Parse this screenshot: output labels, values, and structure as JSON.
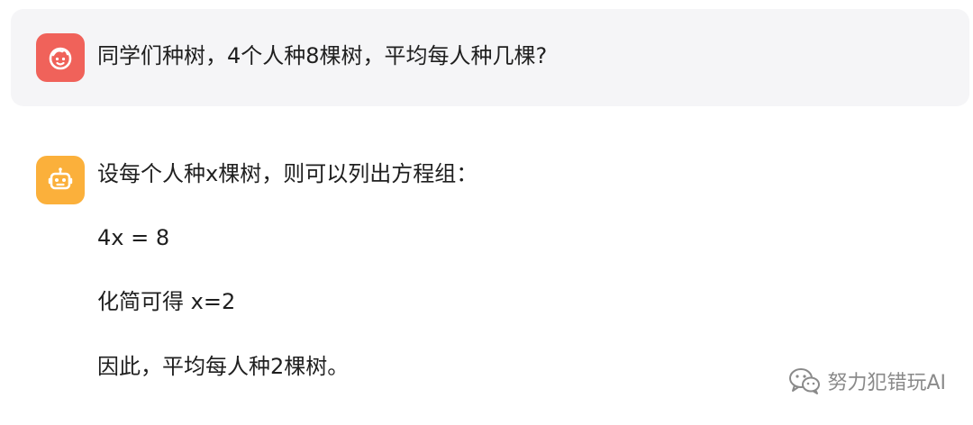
{
  "user_message": {
    "avatar_icon": "smiling-face-icon",
    "text": "同学们种树，4个人种8棵树，平均每人种几棵?"
  },
  "bot_message": {
    "avatar_icon": "robot-icon",
    "lines": [
      "设每个人种x棵树，则可以列出方程组：",
      "4x = 8",
      "化简可得 x=2",
      "因此，平均每人种2棵树。"
    ]
  },
  "watermark": {
    "icon": "wechat-icon",
    "text": "努力犯错玩AI"
  },
  "colors": {
    "user_avatar": "#f0625a",
    "bot_avatar": "#fbb03b",
    "user_bubble_bg": "#f5f5f7",
    "text": "#1f1f1f",
    "watermark": "#8a8a8a"
  }
}
